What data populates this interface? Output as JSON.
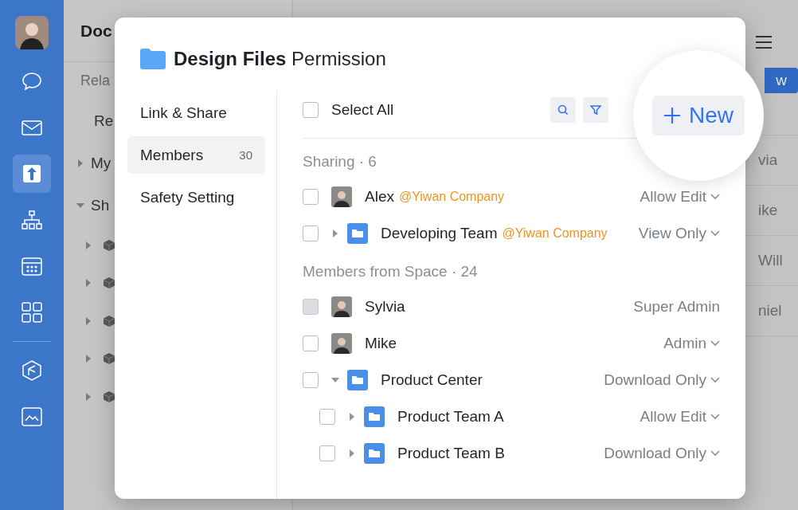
{
  "rail": {
    "items": [
      {
        "kind": "chat",
        "selected": false
      },
      {
        "kind": "mail",
        "selected": false
      },
      {
        "kind": "docs",
        "selected": true
      },
      {
        "kind": "org",
        "selected": false
      },
      {
        "kind": "calendar",
        "selected": false
      },
      {
        "kind": "apps",
        "selected": false
      },
      {
        "kind": "cube",
        "selected": false
      },
      {
        "kind": "gallery",
        "selected": false
      }
    ]
  },
  "background": {
    "title": "Doc",
    "subtitle": "Rela",
    "tree": [
      {
        "label": "Re"
      },
      {
        "label": "My",
        "expanded": false
      },
      {
        "label": "Sh",
        "expanded": true
      }
    ],
    "shared_items": [
      {
        "expanded": false
      },
      {
        "expanded": false
      },
      {
        "expanded": false
      },
      {
        "expanded": false
      },
      {
        "expanded": false
      }
    ],
    "button": "w",
    "rows": [
      "via",
      "ike",
      "Will",
      "niel"
    ]
  },
  "dialog": {
    "title": "**Design Files** Permission",
    "nav": [
      {
        "label": "Link & Share",
        "selected": false
      },
      {
        "label": "Members",
        "count": "30",
        "selected": true
      },
      {
        "label": "Safety Setting",
        "selected": false
      }
    ],
    "select_all": {
      "label": "Select All",
      "checked": false
    },
    "new_button": "New",
    "sections": [
      {
        "title": "Sharing · 6",
        "rows": [
          {
            "kind": "person",
            "name": "Alex",
            "org": "@Yiwan Company",
            "permission": "Allow Edit",
            "dropdown": true,
            "checked": false,
            "disabled": false
          },
          {
            "kind": "group",
            "name": "Developing Team",
            "org": "@Yiwan Company",
            "permission": "View Only",
            "dropdown": true,
            "checked": false,
            "disabled": false,
            "expanded": false
          }
        ]
      },
      {
        "title": "Members from Space · 24",
        "rows": [
          {
            "kind": "person",
            "name": "Sylvia",
            "permission": "Super Admin",
            "dropdown": false,
            "checked": false,
            "disabled": true
          },
          {
            "kind": "person",
            "name": "Mike",
            "permission": "Admin",
            "dropdown": true,
            "checked": false,
            "disabled": false
          },
          {
            "kind": "group",
            "name": "Product Center",
            "permission": "Download Only",
            "dropdown": true,
            "checked": false,
            "disabled": false,
            "expanded": true,
            "children": [
              {
                "kind": "group",
                "name": "Product Team A",
                "permission": "Allow Edit",
                "dropdown": true,
                "checked": false,
                "disabled": false,
                "expanded": false
              },
              {
                "kind": "group",
                "name": "Product Team B",
                "permission": "Download Only",
                "dropdown": true,
                "checked": false,
                "disabled": false,
                "expanded": false
              }
            ]
          }
        ]
      }
    ]
  }
}
